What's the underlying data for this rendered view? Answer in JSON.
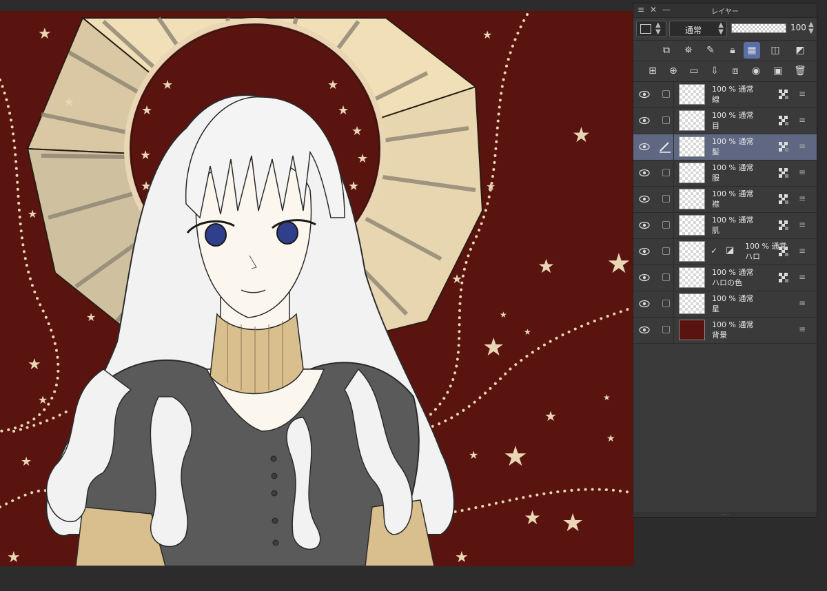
{
  "panel": {
    "title": "レイヤー",
    "blend_mode": "通常",
    "opacity": "100"
  },
  "layers": [
    {
      "opacity": "100 %",
      "mode": "通常",
      "name": "線",
      "active": false,
      "ref_lock": true
    },
    {
      "opacity": "100 %",
      "mode": "通常",
      "name": "目",
      "active": false,
      "ref_lock": true
    },
    {
      "opacity": "100 %",
      "mode": "通常",
      "name": "髪",
      "active": true,
      "ref_lock": true
    },
    {
      "opacity": "100 %",
      "mode": "通常",
      "name": "服",
      "active": false,
      "ref_lock": true
    },
    {
      "opacity": "100 %",
      "mode": "通常",
      "name": "襟",
      "active": false,
      "ref_lock": true
    },
    {
      "opacity": "100 %",
      "mode": "通常",
      "name": "肌",
      "active": false,
      "ref_lock": true
    },
    {
      "opacity": "100 %",
      "mode": "通常",
      "name": "ハロ",
      "active": false,
      "ref_lock": true
    },
    {
      "opacity": "100 %",
      "mode": "通常",
      "name": "ハロの色",
      "active": false,
      "ref_lock": true
    },
    {
      "opacity": "100 %",
      "mode": "通常",
      "name": "星",
      "active": false,
      "ref_lock": false
    },
    {
      "opacity": "100 %",
      "mode": "通常",
      "name": "背景",
      "active": false,
      "ref_lock": false
    }
  ],
  "colors": {
    "background": "#5a1410",
    "halo_light": "#f1dfb8",
    "halo_dark": "#8d8573",
    "hair": "#f2f2f2",
    "dress": "#5a5a5a",
    "collar": "#d9bf8e",
    "eyes": "#2f3f8c",
    "star": "#e9d6b4",
    "active_layer": "#5f6783"
  }
}
